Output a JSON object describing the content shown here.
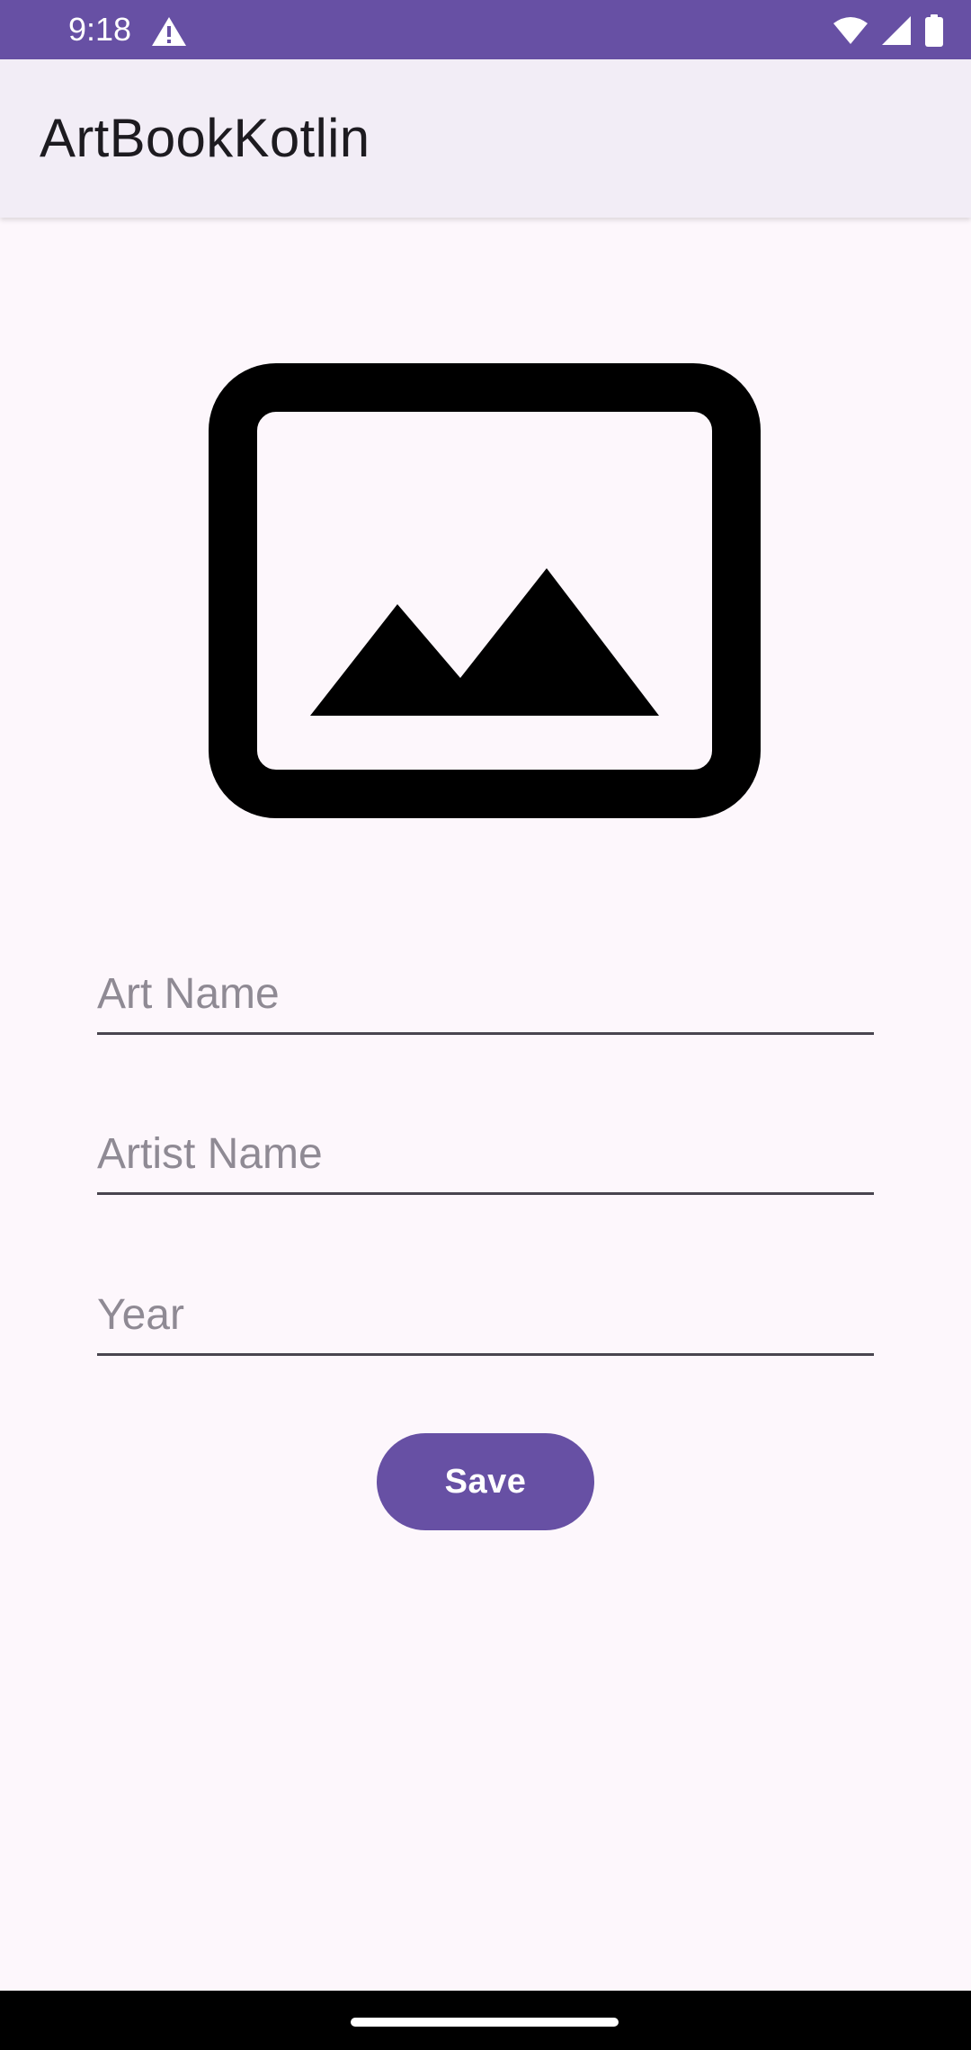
{
  "status_bar": {
    "time": "9:18",
    "background_color": "#6750a4",
    "icons": [
      "warning-icon",
      "wifi-icon",
      "cellular-signal-icon",
      "battery-icon"
    ]
  },
  "app_bar": {
    "title": "ArtBookKotlin"
  },
  "image_picker": {
    "icon": "image-placeholder-icon"
  },
  "form": {
    "art_name": {
      "value": "",
      "placeholder": "Art Name"
    },
    "artist_name": {
      "value": "",
      "placeholder": "Artist Name"
    },
    "year": {
      "value": "",
      "placeholder": "Year"
    },
    "save_label": "Save"
  },
  "colors": {
    "primary": "#6750a4",
    "background": "#fdf7fc",
    "app_bar_background": "#f2edf6",
    "hint_text": "#8f8a94"
  }
}
